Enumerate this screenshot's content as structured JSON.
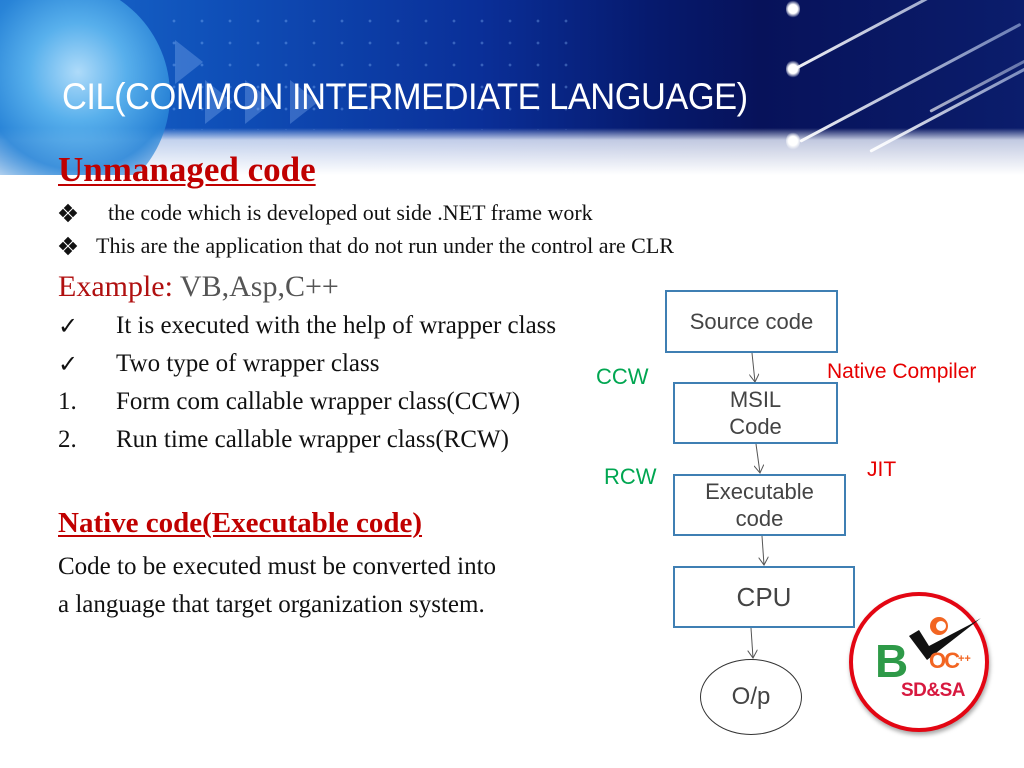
{
  "slide": {
    "title": "CIL(COMMON INTERMEDIATE LANGUAGE)"
  },
  "unmanaged": {
    "heading": "Unmanaged code",
    "bullets": [
      " the code which is developed out side  .NET frame work",
      "This are the application that do not run under the control are CLR"
    ],
    "example_label": "Example:",
    "example_value": " VB,Asp,C++",
    "check_items": [
      "It is  executed with the help of wrapper class",
      "Two type of wrapper  class"
    ],
    "numbered_items": [
      {
        "marker": "1.",
        "text": "Form com callable wrapper class(CCW)"
      },
      {
        "marker": "2.",
        "text": "Run time callable wrapper class(RCW)"
      }
    ]
  },
  "native": {
    "heading": "Native code(Executable code)",
    "lines": [
      "Code to be executed must be converted into",
      " a language that target organization system."
    ]
  },
  "diagram": {
    "nodes": {
      "source": "Source code",
      "msil": [
        "MSIL",
        "Code"
      ],
      "exec": [
        "Executable",
        "code"
      ],
      "cpu": "CPU",
      "output": "O/p"
    },
    "labels": {
      "ccw": "CCW",
      "rcw": "RCW",
      "native_compiler": "Native Compiler",
      "jit": "JIT"
    },
    "colors": {
      "box_border": "#3f7fb3",
      "green_label": "#00a651",
      "red_label": "#e60000"
    }
  },
  "logo": {
    "letter": "B",
    "oc": "OC",
    "plus": "++",
    "text": "SD&SA"
  },
  "icons": {
    "diamond_bullet": "four-diamond-bullet-icon",
    "check": "checkmark-icon"
  },
  "glyphs": {
    "check": "✓"
  }
}
